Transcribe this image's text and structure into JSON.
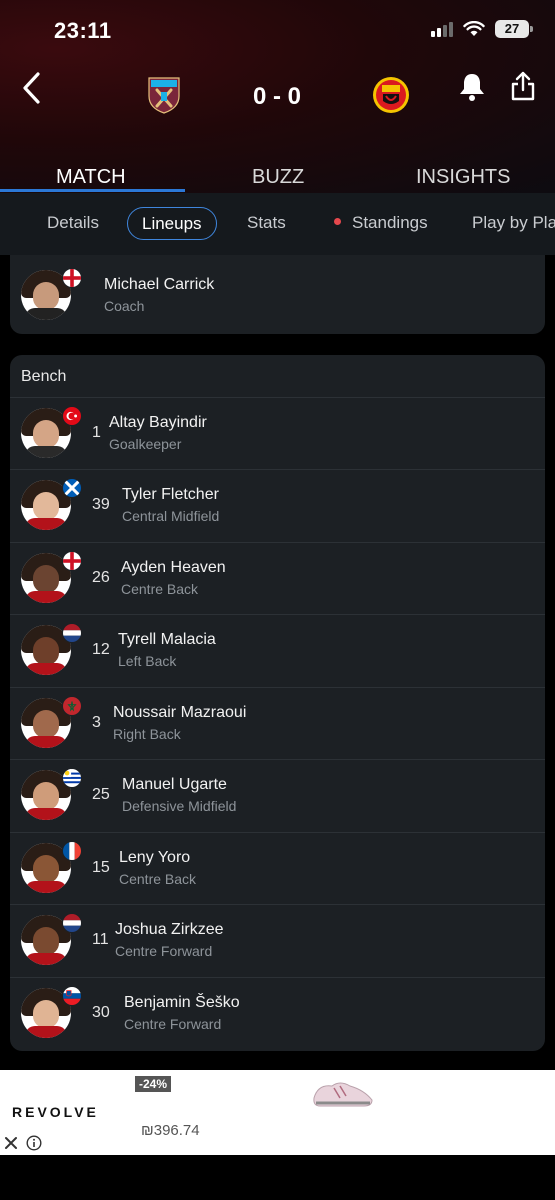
{
  "status_bar": {
    "time": "23:11",
    "battery": "27"
  },
  "match": {
    "score": "0 - 0",
    "home_team_logo": "west-ham-crest-icon",
    "away_team_logo": "manchester-united-crest-icon"
  },
  "main_tabs": [
    {
      "label": "MATCH",
      "active": true
    },
    {
      "label": "BUZZ"
    },
    {
      "label": "INSIGHTS"
    }
  ],
  "sub_tabs": [
    {
      "label": "Details"
    },
    {
      "label": "Lineups",
      "active": true
    },
    {
      "label": "Stats"
    },
    {
      "label": "Standings",
      "live_dot": true
    },
    {
      "label": "Play by Pla"
    }
  ],
  "coach": {
    "name": "Michael Carrick",
    "role": "Coach",
    "flag": "england"
  },
  "bench": {
    "title": "Bench",
    "players": [
      {
        "number": "1",
        "name": "Altay Bayindir",
        "position": "Goalkeeper",
        "flag": "turkey"
      },
      {
        "number": "39",
        "name": "Tyler Fletcher",
        "position": "Central Midfield",
        "flag": "scotland"
      },
      {
        "number": "26",
        "name": "Ayden Heaven",
        "position": "Centre Back",
        "flag": "england"
      },
      {
        "number": "12",
        "name": "Tyrell Malacia",
        "position": "Left Back",
        "flag": "netherlands"
      },
      {
        "number": "3",
        "name": "Noussair Mazraoui",
        "position": "Right Back",
        "flag": "morocco"
      },
      {
        "number": "25",
        "name": "Manuel Ugarte",
        "position": "Defensive Midfield",
        "flag": "uruguay"
      },
      {
        "number": "15",
        "name": "Leny Yoro",
        "position": "Centre Back",
        "flag": "france"
      },
      {
        "number": "11",
        "name": "Joshua Zirkzee",
        "position": "Centre Forward",
        "flag": "netherlands"
      },
      {
        "number": "30",
        "name": "Benjamin Šeško",
        "position": "Centre Forward",
        "flag": "slovenia"
      }
    ]
  },
  "ad": {
    "brand": "REVOLVE",
    "discount": "-24%",
    "price": "₪396.74"
  },
  "colors": {
    "accent": "#2b78d6",
    "live_dot": "#e5484d",
    "card_bg": "#1c2024",
    "subtab_bar": "#15191d"
  }
}
